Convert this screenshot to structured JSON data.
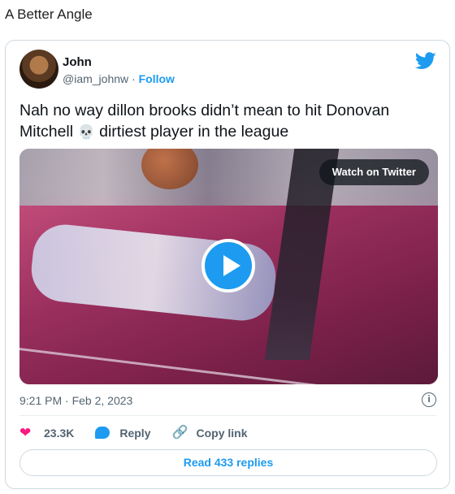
{
  "page": {
    "heading": "A Better Angle"
  },
  "tweet": {
    "author_name": "John",
    "handle": "@iam_johnw",
    "separator": "·",
    "follow_label": "Follow",
    "text_part1": "Nah no way dillon brooks didn’t mean to hit Donovan Mitchell",
    "emoji": "💀",
    "text_part2": "dirtiest player in the league",
    "timestamp": "9:21 PM · Feb 2, 2023",
    "media": {
      "watch_label": "Watch on Twitter"
    },
    "actions": {
      "likes": "23.3K",
      "reply": "Reply",
      "copy_link": "Copy link"
    },
    "read_replies": "Read 433 replies"
  },
  "colors": {
    "brand_blue": "#1d9bf0",
    "like_pink": "#f91880",
    "secondary_text": "#536471"
  },
  "icons": [
    "twitter-bird-icon",
    "play-icon",
    "info-icon",
    "heart-icon",
    "reply-bubble-icon",
    "link-icon"
  ]
}
